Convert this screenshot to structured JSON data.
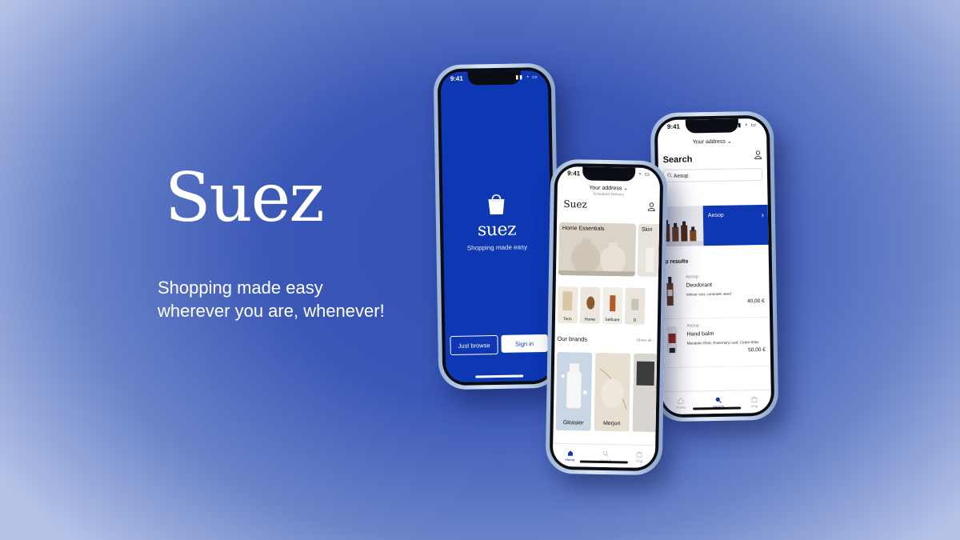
{
  "brand": {
    "logo_text": "Suez",
    "tagline_line1": "Shopping made easy",
    "tagline_line2": "wherever you are, whenever!"
  },
  "colors": {
    "accent": "#0d37b3",
    "background": "#3a57b6"
  },
  "phone_splash": {
    "time": "9:41",
    "logo_text": "suez",
    "tagline": "Shopping made easy",
    "just_browse_label": "Just browse",
    "sign_in_label": "Sign in"
  },
  "phone_home": {
    "time": "9:41",
    "address": "Your address",
    "address_sub": "Scheduled Delivery",
    "logo_text": "Suez",
    "categories": [
      {
        "label": "Home Essentials"
      },
      {
        "label": "Skin"
      }
    ],
    "tiles": [
      "Tech",
      "Home",
      "Selfcare",
      "D"
    ],
    "brands_title": "Our brands",
    "show_all": "Show all",
    "brands": [
      "Glossier",
      "Merjuri"
    ],
    "tabs": [
      "Home",
      "Search",
      "Bag"
    ]
  },
  "phone_search": {
    "time": "9:41",
    "address": "Your address",
    "title": "Search",
    "search_value": "Aesop",
    "feature_label": "Aesop",
    "section_title": "op results",
    "results": [
      {
        "brand": "Aesop",
        "name": "Deodorant",
        "desc": "Vetiver root, coriander seed",
        "price": "40,00 €"
      },
      {
        "brand": "Aesop",
        "name": "Hand balm",
        "desc": "Mandarin Rind, Rosemary Leaf, Cedar Atlas",
        "price": "50,00 €"
      }
    ],
    "tabs": [
      "Home",
      "Search",
      "Bag"
    ]
  }
}
